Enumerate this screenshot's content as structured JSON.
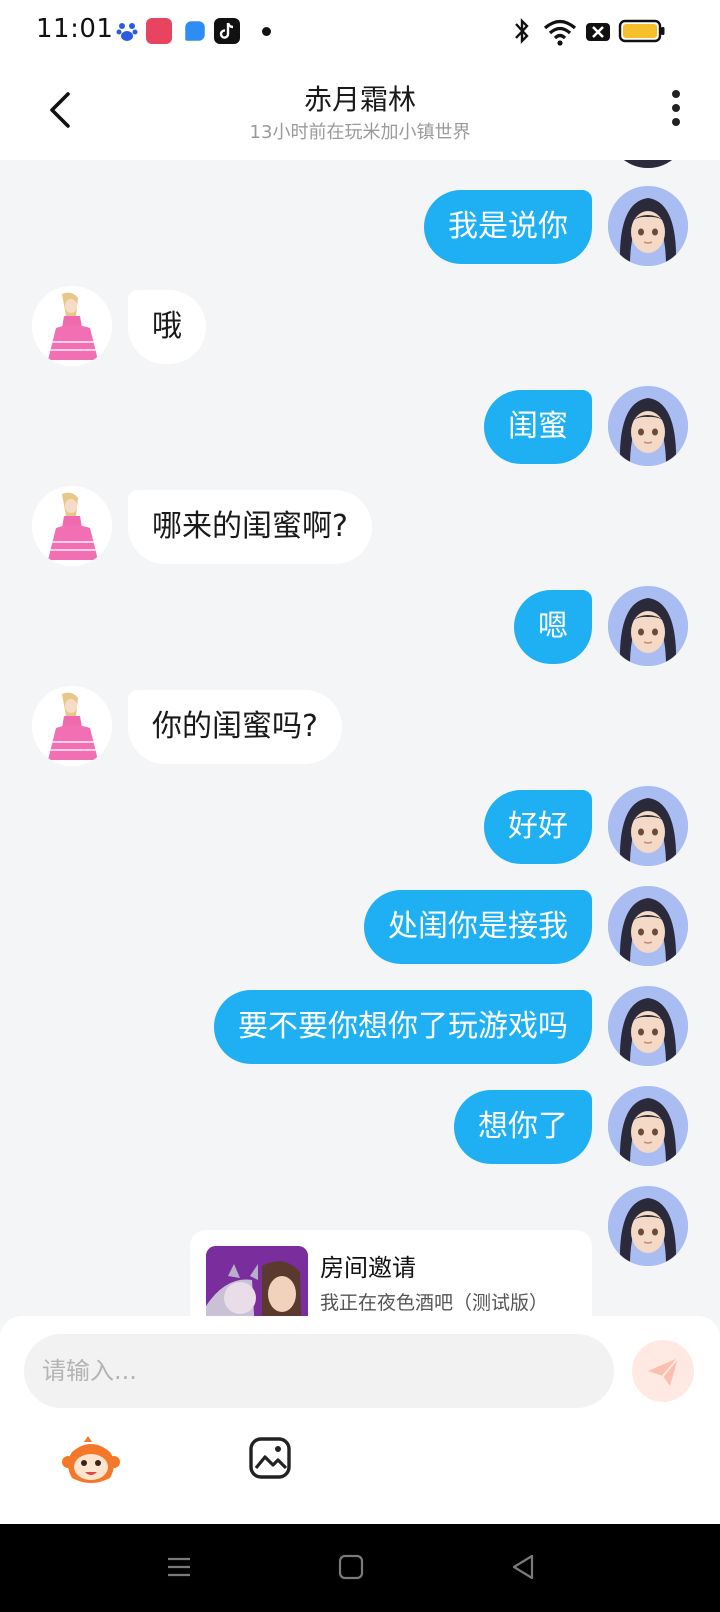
{
  "status_bar": {
    "time": "11:01"
  },
  "header": {
    "title": "赤月霜林",
    "subtitle": "13小时前在玩米加小镇世界"
  },
  "messages": [
    {
      "side": "out",
      "text": "我是说你"
    },
    {
      "side": "in",
      "text": "哦"
    },
    {
      "side": "out",
      "text": "闺蜜"
    },
    {
      "side": "in",
      "text": "哪来的闺蜜啊?"
    },
    {
      "side": "out",
      "text": "嗯"
    },
    {
      "side": "in",
      "text": "你的闺蜜吗?"
    },
    {
      "side": "out",
      "text": "好好"
    },
    {
      "side": "out",
      "text": "处闺你是接我"
    },
    {
      "side": "out",
      "text": "要不要你想你了玩游戏吗"
    },
    {
      "side": "out",
      "text": "想你了"
    }
  ],
  "invite_card": {
    "title": "房间邀请",
    "description": "我正在夜色酒吧（测试版）"
  },
  "input": {
    "placeholder": "请输入..."
  },
  "colors": {
    "outgoing_bubble": "#1fb0f3",
    "incoming_bubble": "#ffffff",
    "chat_background": "#f4f5f7",
    "send_button": "#ffe9e2"
  }
}
